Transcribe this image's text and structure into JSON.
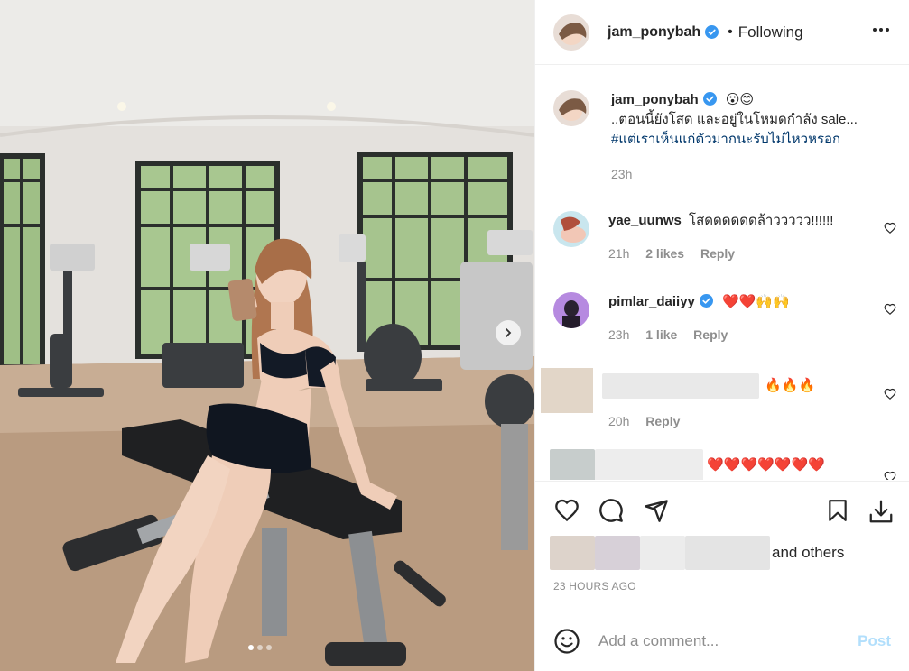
{
  "post": {
    "author": "jam_ponybah",
    "follow_status": "Following",
    "caption_text": "..ตอนนี้ยังโสด และอยู่ในโหมดกำลัง sale...",
    "caption_emoji": "😮😊",
    "caption_hashtag": "#แต่เราเห็นแก่ตัวมากนะรับไม่ไหวหรอก",
    "caption_time": "23h",
    "likes_suffix": "and others",
    "timestamp": "23 HOURS AGO",
    "photo_page": 1,
    "photo_count": 3
  },
  "comments": [
    {
      "username": "yae_uunws",
      "verified": false,
      "text": "โสดดดดดดล้าววววว!!!!!!",
      "time": "21h",
      "likes": "2 likes",
      "reply": "Reply"
    },
    {
      "username": "pimlar_daiiyy",
      "verified": true,
      "text": "❤️❤️🙌🙌",
      "time": "23h",
      "likes": "1 like",
      "reply": "Reply"
    },
    {
      "username": "",
      "verified": false,
      "text": "🔥🔥🔥",
      "time": "20h",
      "likes": "",
      "reply": "Reply"
    },
    {
      "username": "",
      "verified": false,
      "text": "❤️❤️❤️❤️❤️❤️❤️",
      "time": "",
      "likes": "",
      "reply": ""
    }
  ],
  "add_comment": {
    "placeholder": "Add a comment...",
    "post_label": "Post"
  },
  "icons": [
    "more-icon",
    "verified-icon",
    "heart-icon",
    "comment-icon",
    "share-icon",
    "bookmark-icon",
    "download-icon",
    "emoji-icon",
    "chevron-right-icon"
  ],
  "colors": {
    "verified": "#3897f0",
    "link": "#00376b",
    "muted": "#8e8e8e",
    "post_disabled": "#b2dffc",
    "border": "#efefef"
  }
}
